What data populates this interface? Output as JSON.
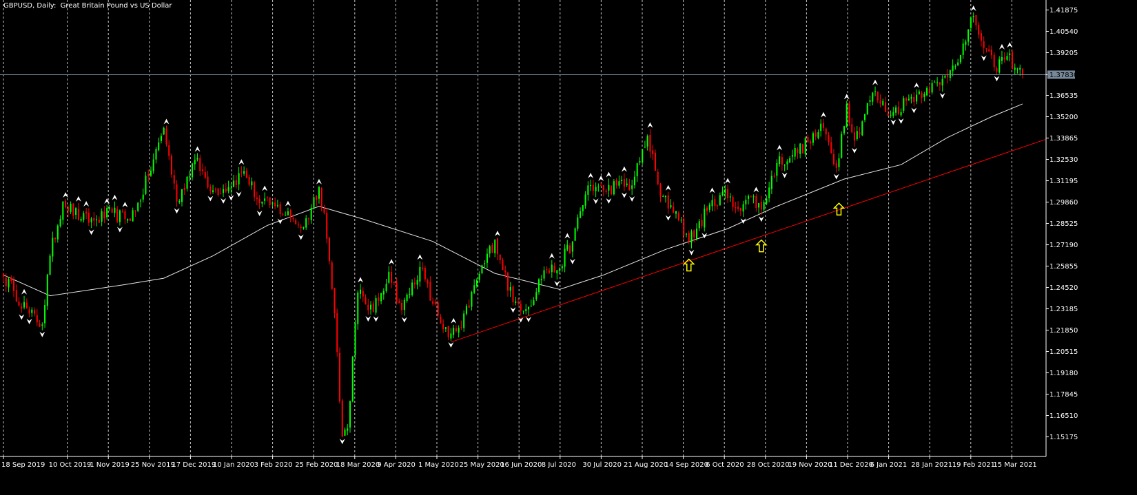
{
  "window": {
    "title": "GBPUSD, Daily:  Great Britain Pound vs US Dollar"
  },
  "colors": {
    "background": "#000000",
    "bull": "#00ff00",
    "bear": "#ff0000",
    "grid": "#c8c8c8",
    "moving_average": "#e6e6e6",
    "trendline": "#ff0000",
    "current_price_line": "#778899",
    "arrow_marker": "#ffff00",
    "fractal": "#ffffff"
  },
  "chart_data": {
    "type": "candlestick",
    "title": "GBPUSD, Daily:  Great Britain Pound vs US Dollar",
    "xlabel": "",
    "ylabel": "",
    "grid": true,
    "ylim": [
      1.1395,
      1.425
    ],
    "y_ticks": [
      "1.41875",
      "1.40540",
      "1.39205",
      "1.37830",
      "1.36535",
      "1.35200",
      "1.33865",
      "1.32530",
      "1.31195",
      "1.29860",
      "1.28525",
      "1.27190",
      "1.25855",
      "1.24520",
      "1.23185",
      "1.21850",
      "1.20515",
      "1.19180",
      "1.17845",
      "1.16510",
      "1.15175"
    ],
    "x_ticks": [
      "18 Sep 2019",
      "10 Oct 2019",
      "1 Nov 2019",
      "25 Nov 2019",
      "17 Dec 2019",
      "10 Jan 2020",
      "3 Feb 2020",
      "25 Feb 2020",
      "18 Mar 2020",
      "9 Apr 2020",
      "1 May 2020",
      "25 May 2020",
      "16 Jun 2020",
      "8 Jul 2020",
      "30 Jul 2020",
      "21 Aug 2020",
      "14 Sep 2020",
      "6 Oct 2020",
      "28 Oct 2020",
      "19 Nov 2020",
      "11 Dec 2020",
      "6 Jan 2021",
      "28 Jan 2021",
      "19 Feb 2021",
      "15 Mar 2021"
    ],
    "current_price": "1.37830",
    "anchors": [
      {
        "date": "2019-09-18",
        "close": 1.252
      },
      {
        "date": "2019-09-24",
        "close": 1.243
      },
      {
        "date": "2019-10-02",
        "close": 1.229
      },
      {
        "date": "2019-10-09",
        "close": 1.222
      },
      {
        "date": "2019-10-14",
        "close": 1.265
      },
      {
        "date": "2019-10-21",
        "close": 1.299
      },
      {
        "date": "2019-10-30",
        "close": 1.288
      },
      {
        "date": "2019-11-06",
        "close": 1.287
      },
      {
        "date": "2019-11-15",
        "close": 1.292
      },
      {
        "date": "2019-11-22",
        "close": 1.288
      },
      {
        "date": "2019-11-28",
        "close": 1.293
      },
      {
        "date": "2019-12-05",
        "close": 1.315
      },
      {
        "date": "2019-12-13",
        "close": 1.345
      },
      {
        "date": "2019-12-20",
        "close": 1.299
      },
      {
        "date": "2019-12-31",
        "close": 1.325
      },
      {
        "date": "2020-01-09",
        "close": 1.306
      },
      {
        "date": "2020-01-17",
        "close": 1.308
      },
      {
        "date": "2020-01-27",
        "close": 1.318
      },
      {
        "date": "2020-02-04",
        "close": 1.298
      },
      {
        "date": "2020-02-12",
        "close": 1.296
      },
      {
        "date": "2020-02-20",
        "close": 1.289
      },
      {
        "date": "2020-02-27",
        "close": 1.283
      },
      {
        "date": "2020-03-06",
        "close": 1.308
      },
      {
        "date": "2020-03-10",
        "close": 1.292
      },
      {
        "date": "2020-03-16",
        "close": 1.229
      },
      {
        "date": "2020-03-19",
        "close": 1.152
      },
      {
        "date": "2020-03-23",
        "close": 1.157
      },
      {
        "date": "2020-03-27",
        "close": 1.242
      },
      {
        "date": "2020-04-06",
        "close": 1.23
      },
      {
        "date": "2020-04-14",
        "close": 1.255
      },
      {
        "date": "2020-04-21",
        "close": 1.231
      },
      {
        "date": "2020-04-30",
        "close": 1.258
      },
      {
        "date": "2020-05-07",
        "close": 1.235
      },
      {
        "date": "2020-05-15",
        "close": 1.214
      },
      {
        "date": "2020-05-22",
        "close": 1.22
      },
      {
        "date": "2020-06-01",
        "close": 1.25
      },
      {
        "date": "2020-06-10",
        "close": 1.275
      },
      {
        "date": "2020-06-19",
        "close": 1.236
      },
      {
        "date": "2020-06-29",
        "close": 1.233
      },
      {
        "date": "2020-07-07",
        "close": 1.256
      },
      {
        "date": "2020-07-14",
        "close": 1.256
      },
      {
        "date": "2020-07-22",
        "close": 1.274
      },
      {
        "date": "2020-07-30",
        "close": 1.309
      },
      {
        "date": "2020-08-07",
        "close": 1.306
      },
      {
        "date": "2020-08-14",
        "close": 1.309
      },
      {
        "date": "2020-08-24",
        "close": 1.309
      },
      {
        "date": "2020-09-01",
        "close": 1.34
      },
      {
        "date": "2020-09-08",
        "close": 1.302
      },
      {
        "date": "2020-09-16",
        "close": 1.293
      },
      {
        "date": "2020-09-23",
        "close": 1.274
      },
      {
        "date": "2020-10-02",
        "close": 1.293
      },
      {
        "date": "2020-10-12",
        "close": 1.305
      },
      {
        "date": "2020-10-19",
        "close": 1.295
      },
      {
        "date": "2020-10-27",
        "close": 1.302
      },
      {
        "date": "2020-11-02",
        "close": 1.294
      },
      {
        "date": "2020-11-10",
        "close": 1.323
      },
      {
        "date": "2020-11-18",
        "close": 1.328
      },
      {
        "date": "2020-11-26",
        "close": 1.336
      },
      {
        "date": "2020-12-04",
        "close": 1.345
      },
      {
        "date": "2020-12-11",
        "close": 1.32
      },
      {
        "date": "2020-12-17",
        "close": 1.36
      },
      {
        "date": "2020-12-22",
        "close": 1.337
      },
      {
        "date": "2020-12-31",
        "close": 1.367
      },
      {
        "date": "2021-01-11",
        "close": 1.353
      },
      {
        "date": "2021-01-19",
        "close": 1.362
      },
      {
        "date": "2021-01-29",
        "close": 1.37
      },
      {
        "date": "2021-02-05",
        "close": 1.372
      },
      {
        "date": "2021-02-12",
        "close": 1.384
      },
      {
        "date": "2021-02-19",
        "close": 1.399
      },
      {
        "date": "2021-02-24",
        "close": 1.415
      },
      {
        "date": "2021-03-02",
        "close": 1.395
      },
      {
        "date": "2021-03-08",
        "close": 1.383
      },
      {
        "date": "2021-03-15",
        "close": 1.39
      },
      {
        "date": "2021-03-23",
        "close": 1.3783
      }
    ],
    "moving_average": [
      {
        "date": "2019-09-18",
        "value": 1.253
      },
      {
        "date": "2019-10-14",
        "value": 1.24
      },
      {
        "date": "2019-11-22",
        "value": 1.247
      },
      {
        "date": "2019-12-13",
        "value": 1.251
      },
      {
        "date": "2020-01-09",
        "value": 1.265
      },
      {
        "date": "2020-02-07",
        "value": 1.284
      },
      {
        "date": "2020-03-06",
        "value": 1.296
      },
      {
        "date": "2020-03-31",
        "value": 1.288
      },
      {
        "date": "2020-05-07",
        "value": 1.274
      },
      {
        "date": "2020-06-10",
        "value": 1.254
      },
      {
        "date": "2020-07-15",
        "value": 1.244
      },
      {
        "date": "2020-08-07",
        "value": 1.253
      },
      {
        "date": "2020-09-10",
        "value": 1.269
      },
      {
        "date": "2020-10-14",
        "value": 1.282
      },
      {
        "date": "2020-11-10",
        "value": 1.296
      },
      {
        "date": "2020-12-16",
        "value": 1.313
      },
      {
        "date": "2021-01-15",
        "value": 1.322
      },
      {
        "date": "2021-02-10",
        "value": 1.339
      },
      {
        "date": "2021-03-05",
        "value": 1.352
      },
      {
        "date": "2021-03-23",
        "value": 1.36
      }
    ],
    "trendline": [
      {
        "date": "2020-05-18",
        "value": 1.211
      },
      {
        "date": "2021-04-10",
        "value": 1.34
      }
    ],
    "arrow_markers": [
      {
        "date": "2020-09-23",
        "value": 1.259
      },
      {
        "date": "2020-11-02",
        "value": 1.271
      },
      {
        "date": "2020-12-14",
        "value": 1.294
      }
    ]
  }
}
